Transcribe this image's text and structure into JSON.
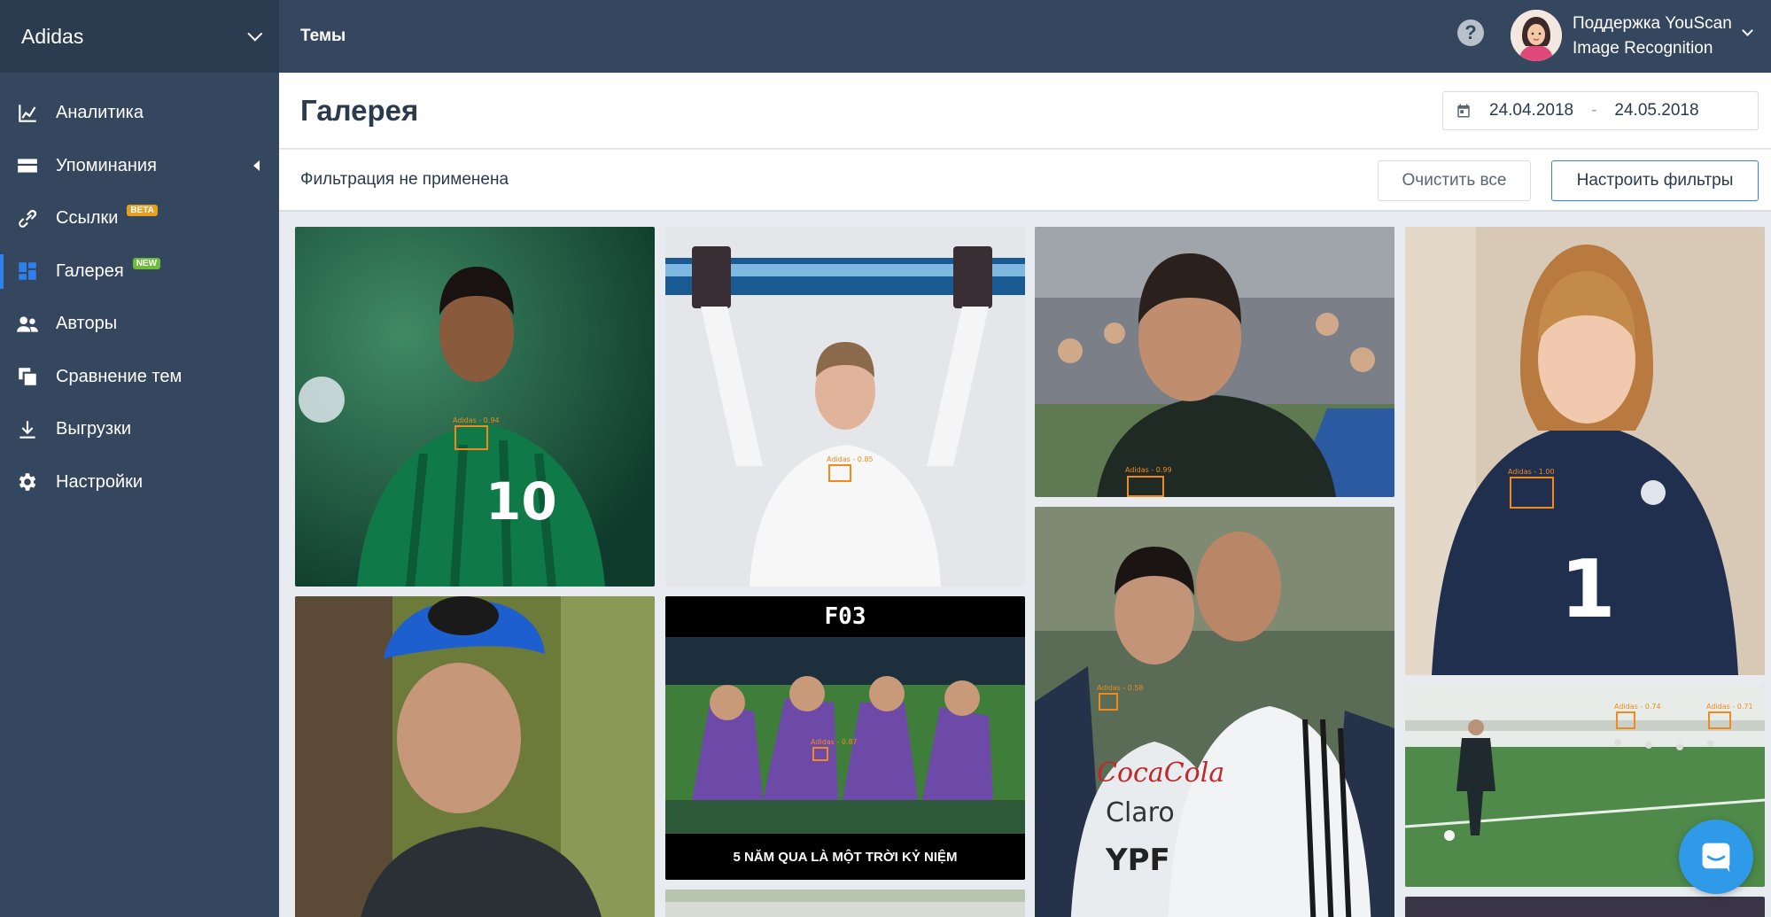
{
  "brand": {
    "name": "Adidas"
  },
  "nav": [
    {
      "label": "Аналитика",
      "icon": "chart-line-icon",
      "badge": ""
    },
    {
      "label": "Упоминания",
      "icon": "mentions-icon",
      "badge": ""
    },
    {
      "label": "Ссылки",
      "icon": "link-icon",
      "badge": "BETA"
    },
    {
      "label": "Галерея",
      "icon": "gallery-icon",
      "badge": "NEW",
      "active": true
    },
    {
      "label": "Авторы",
      "icon": "authors-icon",
      "badge": ""
    },
    {
      "label": "Сравнение тем",
      "icon": "compare-icon",
      "badge": ""
    },
    {
      "label": "Выгрузки",
      "icon": "download-icon",
      "badge": ""
    },
    {
      "label": "Настройки",
      "icon": "gear-icon",
      "badge": ""
    }
  ],
  "topbar": {
    "title": "Темы",
    "help_symbol": "?",
    "user_line1": "Поддержка YouScan",
    "user_line2": "Image Recognition"
  },
  "header": {
    "title": "Галерея",
    "date_from": "24.04.2018",
    "date_sep": "-",
    "date_to": "24.05.2018"
  },
  "filters": {
    "status": "Фильтрация не применена",
    "clear_label": "Очистить все",
    "configure_label": "Настроить фильтры"
  },
  "gallery": {
    "labels": [
      "Adidas - 0.94",
      "Adidas - 0.85",
      "Adidas - 0.99",
      "Adidas - 1.00",
      "Adidas - 0.87",
      "Adidas - 0.58",
      "Adidas - 0.74",
      "Adidas - 0.71"
    ],
    "meme_top": "F03",
    "meme_bottom": "5 NĂM QUA LÀ MỘT TRỜI KỶ NIỆM"
  },
  "colors": {
    "sidebar": "#34475f",
    "accent": "#2f80ed",
    "detection": "#f08a1c",
    "beta_badge": "#e6a021",
    "new_badge": "#6dbb3a"
  }
}
